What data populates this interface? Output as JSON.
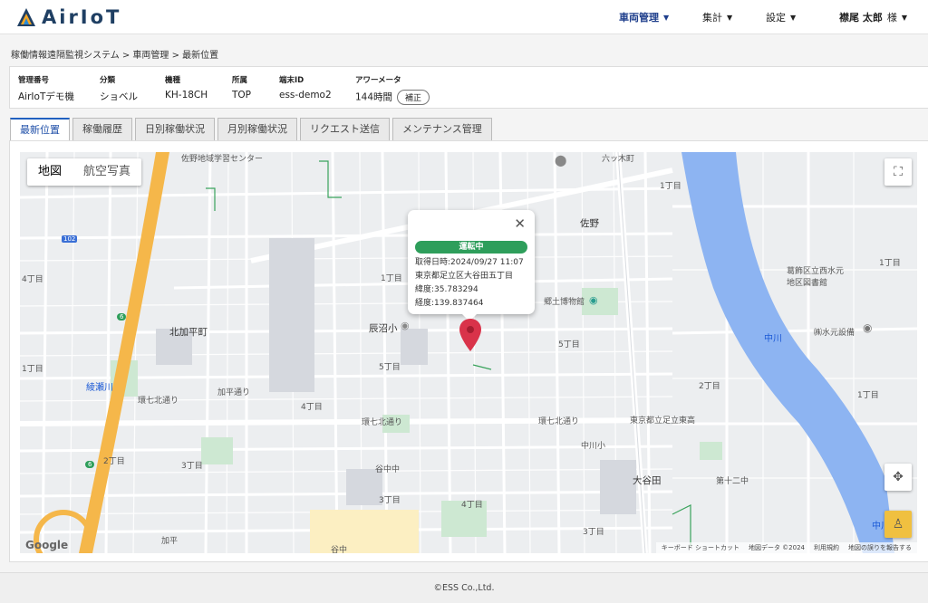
{
  "app": {
    "name": "AirIoT"
  },
  "nav": {
    "items": [
      {
        "label": "車両管理",
        "active": true
      },
      {
        "label": "集計",
        "active": false
      },
      {
        "label": "設定",
        "active": false
      }
    ],
    "user_name": "襟尾 太郎",
    "user_suffix": "様"
  },
  "breadcrumb": "稼働情報遠隔監視システム > 車両管理 > 最新位置",
  "vehicle": {
    "fields": [
      {
        "label": "管理番号",
        "value": "AirIoTデモ機"
      },
      {
        "label": "分類",
        "value": "ショベル"
      },
      {
        "label": "機種",
        "value": "KH-18CH"
      },
      {
        "label": "所属",
        "value": "TOP"
      },
      {
        "label": "端末ID",
        "value": "ess-demo2"
      },
      {
        "label": "アワーメータ",
        "value": "144時間"
      }
    ],
    "correct_button": "補正"
  },
  "tabs": [
    "最新位置",
    "稼働履歴",
    "日別稼働状況",
    "月別稼働状況",
    "リクエスト送信",
    "メンテナンス管理"
  ],
  "active_tab": "最新位置",
  "map": {
    "type_buttons": [
      "地図",
      "航空写真"
    ],
    "selected_type": "地図",
    "popup": {
      "status": "運転中",
      "status_color": "#2e9e5b",
      "time_line": "取得日時:2024/09/27 11:07",
      "address": "東京都足立区大谷田五丁目",
      "latitude": "緯度:35.783294",
      "longitude": "経度:139.837464"
    },
    "labels": [
      "佐野地域学習センター",
      "六ッ木町",
      "1丁目",
      "佐野",
      "4丁目",
      "北加平町",
      "1丁目",
      "綾瀬川",
      "環七北通り",
      "加平通り",
      "辰沼小",
      "5丁目",
      "4丁目",
      "環七北通り",
      "2丁目",
      "3丁目",
      "谷中中",
      "3丁目",
      "4丁目",
      "加平",
      "谷中",
      "3丁目",
      "1丁目",
      "5丁目",
      "郷土博物館",
      "環七北通り",
      "中川小",
      "大谷田",
      "東京都立足立東高",
      "第十二中",
      "1丁目",
      "2丁目",
      "中川",
      "葛飾区立西水元地区図書館",
      "㈱水元設備",
      "1丁目",
      "中川"
    ],
    "route_label": "102",
    "route_label2": "6",
    "route_label3": "6",
    "attribution": [
      "キーボード ショートカット",
      "地図データ ©2024",
      "利用規約",
      "地図の誤りを報告する"
    ],
    "google": "Google",
    "water_color": "#8db4f2",
    "highway_color": "#f5b74a",
    "pin_color": "#d9334a"
  },
  "footer": "©ESS Co.,Ltd."
}
